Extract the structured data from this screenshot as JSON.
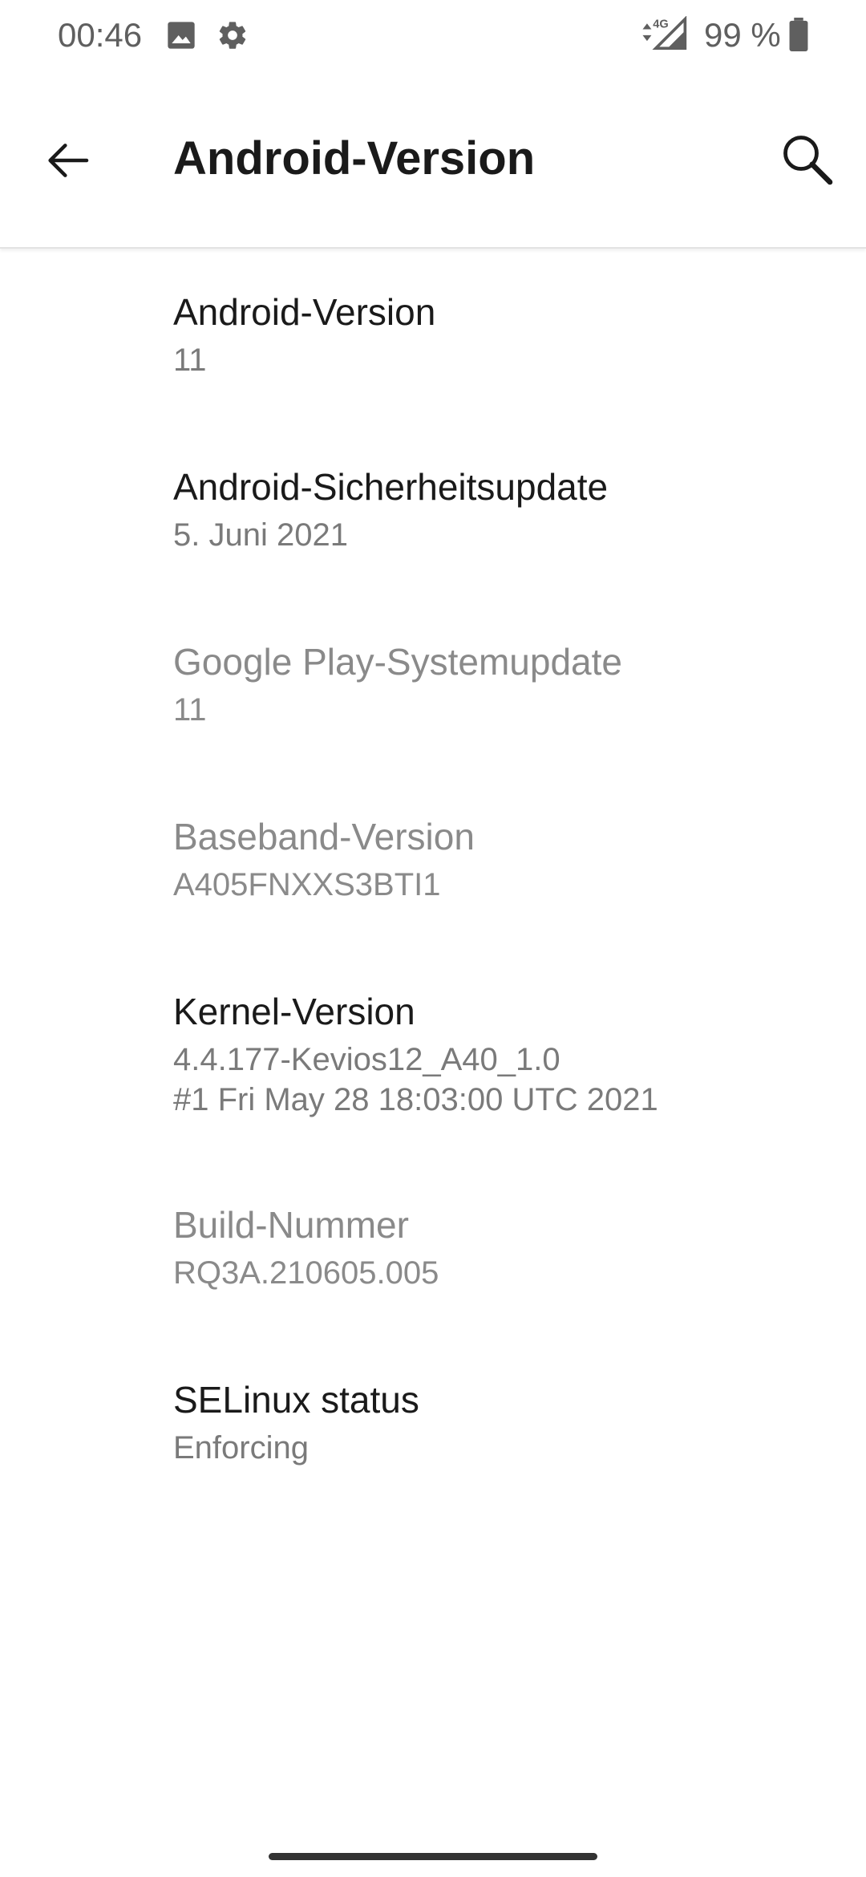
{
  "status_bar": {
    "time": "00:46",
    "icons": [
      "image-icon",
      "gear-icon"
    ],
    "network": "4G",
    "battery_text": "99 %"
  },
  "app_bar": {
    "title": "Android-Version",
    "back_icon": "arrow-back-icon",
    "search_icon": "search-icon"
  },
  "items": [
    {
      "title": "Android-Version",
      "value": "11",
      "enabled": true
    },
    {
      "title": "Android-Sicherheitsupdate",
      "value": "5. Juni 2021",
      "enabled": true
    },
    {
      "title": "Google Play-Systemupdate",
      "value": "11",
      "enabled": false
    },
    {
      "title": "Baseband-Version",
      "value": "A405FNXXS3BTI1",
      "enabled": false
    },
    {
      "title": "Kernel-Version",
      "value": "4.4.177-Kevios12_A40_1.0\n#1 Fri May 28 18:03:00 UTC 2021",
      "enabled": true
    },
    {
      "title": "Build-Nummer",
      "value": "RQ3A.210605.005",
      "enabled": false
    },
    {
      "title": "SELinux status",
      "value": "Enforcing",
      "enabled": true
    }
  ],
  "colors": {
    "primary_text": "#1a1a1a",
    "secondary_text": "#7a7a7a",
    "disabled_text": "#8a8a8a",
    "background": "#ffffff"
  }
}
